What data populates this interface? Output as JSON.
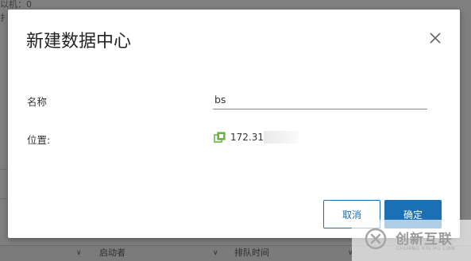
{
  "background": {
    "top_text": "以机：0",
    "side_text": "扌",
    "columns": [
      {
        "label": "启动者"
      },
      {
        "label": "排队时间"
      }
    ]
  },
  "dialog": {
    "title": "新建数据中心",
    "close_icon": "close-icon",
    "name_label": "名称",
    "name_value": "bs",
    "location_label": "位置:",
    "location_icon": "datacenter-host-icon",
    "location_value": "172.31.",
    "cancel_label": "取消",
    "ok_label": "确定"
  },
  "watermark": {
    "brand": "创新互联",
    "subtitle": "CHUANG XIN HU LIAN"
  },
  "colors": {
    "primary": "#1a6fb5",
    "icon_green": "#6cb33f"
  }
}
